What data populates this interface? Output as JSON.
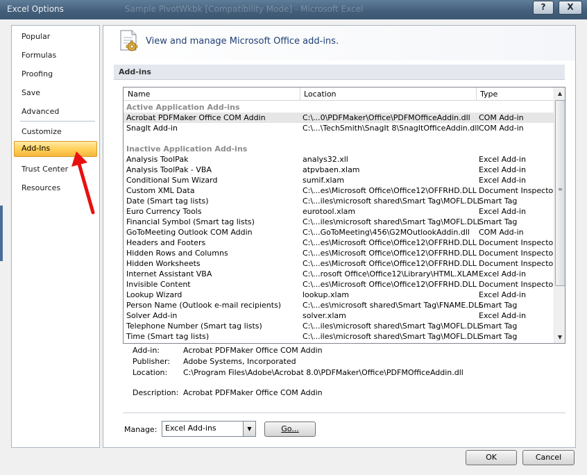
{
  "window": {
    "title": "Excel Options",
    "background_title": "Sample PivotWkbk  [Compatibility Mode] - Microsoft Excel",
    "help_label": "?",
    "close_label": "X"
  },
  "nav": {
    "items": [
      {
        "label": "Popular"
      },
      {
        "label": "Formulas"
      },
      {
        "label": "Proofing"
      },
      {
        "label": "Save"
      },
      {
        "label": "Advanced"
      },
      {
        "label": "Customize"
      },
      {
        "label": "Add-Ins"
      },
      {
        "label": "Trust Center"
      },
      {
        "label": "Resources"
      }
    ],
    "selected": "Add-Ins"
  },
  "main": {
    "heading": "View and manage Microsoft Office add-ins.",
    "section_title": "Add-ins",
    "columns": {
      "name": "Name",
      "location": "Location",
      "type": "Type"
    },
    "groups": [
      {
        "label": "Active Application Add-ins",
        "rows": [
          {
            "name": "Acrobat PDFMaker Office COM Addin",
            "location": "C:\\...0\\PDFMaker\\Office\\PDFMOfficeAddin.dll",
            "type": "COM Add-in"
          },
          {
            "name": "SnagIt Add-in",
            "location": "C:\\...\\TechSmith\\SnagIt 8\\SnagItOfficeAddin.dll",
            "type": "COM Add-in"
          }
        ]
      },
      {
        "label": "Inactive Application Add-ins",
        "rows": [
          {
            "name": "Analysis ToolPak",
            "location": "analys32.xll",
            "type": "Excel Add-in"
          },
          {
            "name": "Analysis ToolPak - VBA",
            "location": "atpvbaen.xlam",
            "type": "Excel Add-in"
          },
          {
            "name": "Conditional Sum Wizard",
            "location": "sumif.xlam",
            "type": "Excel Add-in"
          },
          {
            "name": "Custom XML Data",
            "location": "C:\\...es\\Microsoft Office\\Office12\\OFFRHD.DLL",
            "type": "Document Inspector"
          },
          {
            "name": "Date (Smart tag lists)",
            "location": "C:\\...iles\\microsoft shared\\Smart Tag\\MOFL.DLL",
            "type": "Smart Tag"
          },
          {
            "name": "Euro Currency Tools",
            "location": "eurotool.xlam",
            "type": "Excel Add-in"
          },
          {
            "name": "Financial Symbol (Smart tag lists)",
            "location": "C:\\...iles\\microsoft shared\\Smart Tag\\MOFL.DLL",
            "type": "Smart Tag"
          },
          {
            "name": "GoToMeeting Outlook COM Addin",
            "location": "C:\\...GoToMeeting\\456\\G2MOutlookAddin.dll",
            "type": "COM Add-in"
          },
          {
            "name": "Headers and Footers",
            "location": "C:\\...es\\Microsoft Office\\Office12\\OFFRHD.DLL",
            "type": "Document Inspector"
          },
          {
            "name": "Hidden Rows and Columns",
            "location": "C:\\...es\\Microsoft Office\\Office12\\OFFRHD.DLL",
            "type": "Document Inspector"
          },
          {
            "name": "Hidden Worksheets",
            "location": "C:\\...es\\Microsoft Office\\Office12\\OFFRHD.DLL",
            "type": "Document Inspector"
          },
          {
            "name": "Internet Assistant VBA",
            "location": "C:\\...rosoft Office\\Office12\\Library\\HTML.XLAM",
            "type": "Excel Add-in"
          },
          {
            "name": "Invisible Content",
            "location": "C:\\...es\\Microsoft Office\\Office12\\OFFRHD.DLL",
            "type": "Document Inspector"
          },
          {
            "name": "Lookup Wizard",
            "location": "lookup.xlam",
            "type": "Excel Add-in"
          },
          {
            "name": "Person Name (Outlook e-mail recipients)",
            "location": "C:\\...es\\microsoft shared\\Smart Tag\\FNAME.DLL",
            "type": "Smart Tag"
          },
          {
            "name": "Solver Add-in",
            "location": "solver.xlam",
            "type": "Excel Add-in"
          },
          {
            "name": "Telephone Number (Smart tag lists)",
            "location": "C:\\...iles\\microsoft shared\\Smart Tag\\MOFL.DLL",
            "type": "Smart Tag"
          },
          {
            "name": "Time (Smart tag lists)",
            "location": "C:\\...iles\\microsoft shared\\Smart Tag\\MOFL.DLL",
            "type": "Smart Tag"
          }
        ]
      }
    ],
    "selected_row": "Acrobat PDFMaker Office COM Addin",
    "details": {
      "addin_label": "Add-in:",
      "addin_value": "Acrobat PDFMaker Office COM Addin",
      "publisher_label": "Publisher:",
      "publisher_value": "Adobe Systems, Incorporated",
      "location_label": "Location:",
      "location_value": "C:\\Program Files\\Adobe\\Acrobat 8.0\\PDFMaker\\Office\\PDFMOfficeAddin.dll",
      "description_label": "Description:",
      "description_value": "Acrobat PDFMaker Office COM Addin"
    },
    "manage": {
      "label": "Manage:",
      "selected": "Excel Add-ins",
      "go_label": "Go..."
    }
  },
  "footer": {
    "ok_label": "OK",
    "cancel_label": "Cancel"
  },
  "colors": {
    "selected_nav": "#ffd25a",
    "heading": "#1f3e74",
    "annotation_arrow": "#e8100f"
  }
}
